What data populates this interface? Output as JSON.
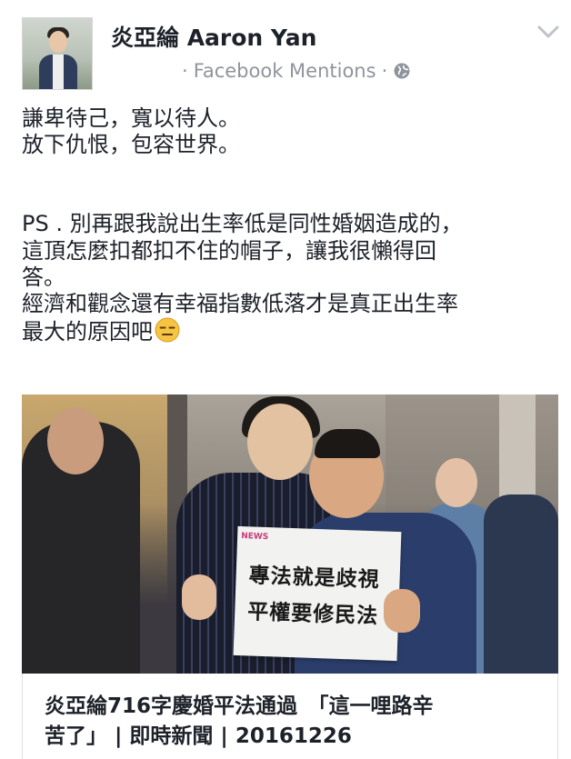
{
  "post": {
    "author": "炎亞綸 Aaron Yan",
    "meta_prefix": "·",
    "source": "Facebook Mentions",
    "meta_suffix": "·",
    "lines": [
      "謙卑待己，寬以待人。",
      "放下仇恨，包容世界。",
      "PS . 別再跟我說出生率低是同性婚姻造成的，",
      "這頂怎麼扣都扣不住的帽子，讓我很懶得回",
      "答。",
      "經濟和觀念還有幸福指數低落才是真正出生率",
      "最大的原因吧"
    ]
  },
  "photo": {
    "sign_tag": "NEWS",
    "sign_line1": "專法就是歧視",
    "sign_line2": "平權要修民法"
  },
  "link": {
    "title_line1": "炎亞綸716字慶婚平法通過　「這一哩路辛",
    "title_line2": "苦了」 | 即時新聞 | 20161226"
  },
  "icons": {
    "dropdown": "chevron-down-icon",
    "audience": "globe-icon",
    "emoji": "expressionless-face-icon"
  },
  "colors": {
    "text": "#1d2129",
    "meta": "#90949c",
    "emoji": "#f6c443"
  }
}
